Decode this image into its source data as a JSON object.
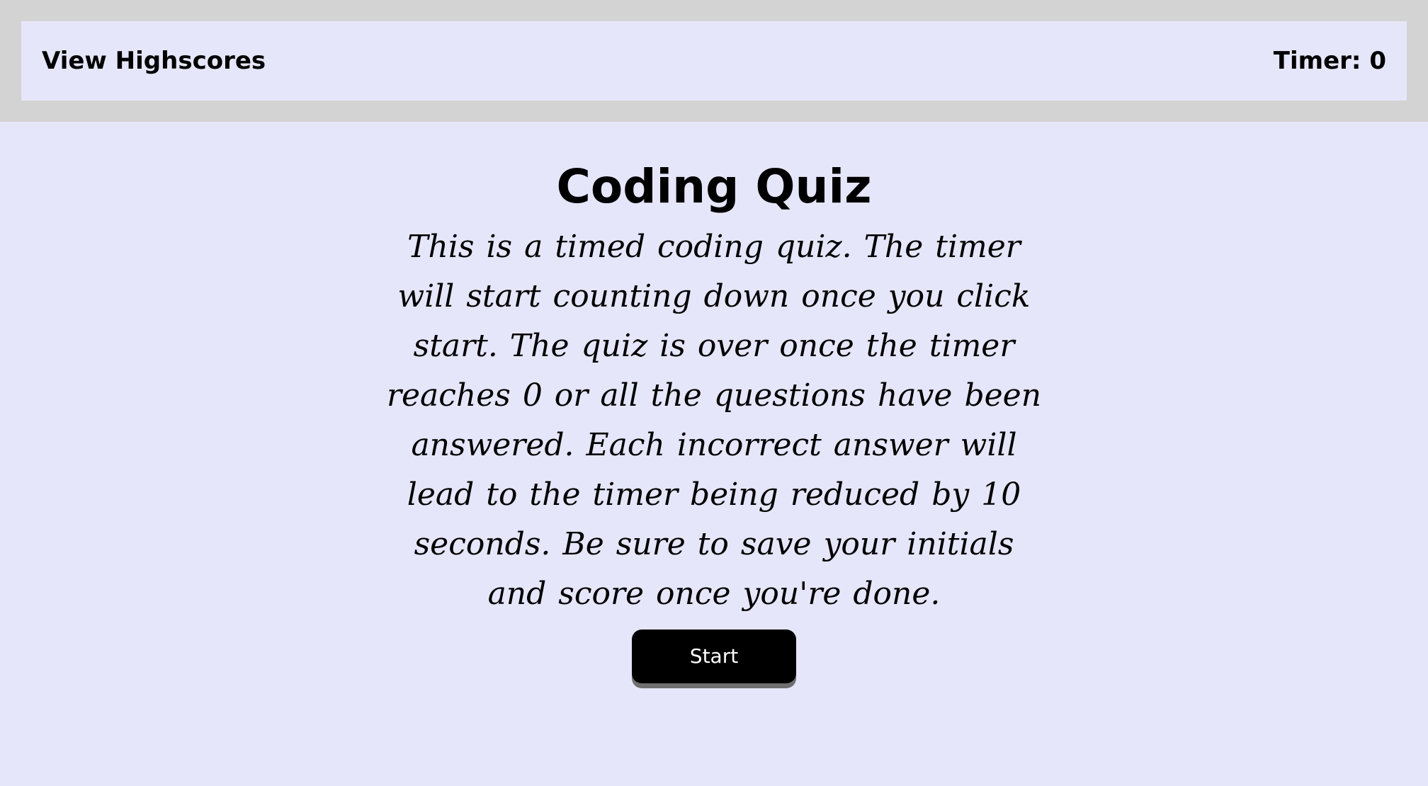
{
  "header": {
    "highscores_label": "View Highscores",
    "timer_text": "Timer: 0"
  },
  "main": {
    "title": "Coding Quiz",
    "description": "This is a timed coding quiz. The timer will start counting down once you click start. The quiz is over once the timer reaches 0 or all the questions have been answered. Each incorrect answer will lead to the timer being reduced by 10 seconds. Be sure to save your initials and score once you're done.",
    "start_label": "Start"
  },
  "colors": {
    "page_background": "#e6e6fa",
    "header_band": "#d3d3d3",
    "button_background": "#000000",
    "button_text": "#ffffff",
    "button_shadow": "#6f6f6f"
  }
}
